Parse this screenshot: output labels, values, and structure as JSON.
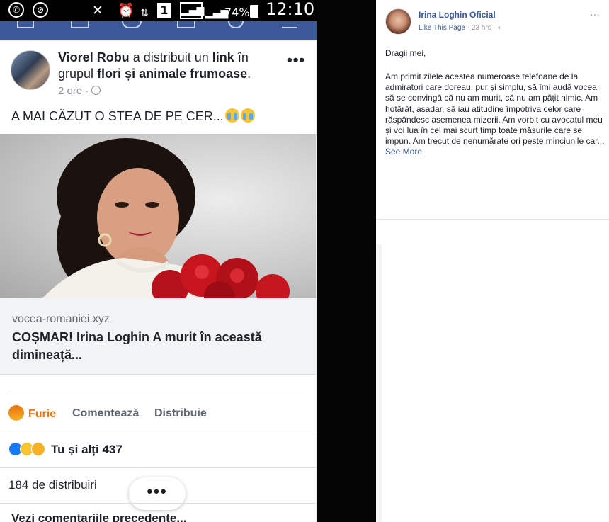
{
  "status_bar": {
    "time": "12:10",
    "battery": "74%",
    "sim_label": "1",
    "icons": [
      "whatsapp-icon",
      "blocked-icon",
      "mute-icon",
      "alarm-icon",
      "data-icon",
      "signal-icon",
      "battery-icon"
    ]
  },
  "mobile_post": {
    "author": "Viorel Robu",
    "action_pre": "a distribuit un",
    "action_link": "link",
    "action_in": "în grupul",
    "group": "flori și animale frumoase",
    "group_dot": ".",
    "time": "2 ore ·",
    "text": "A MAI CĂZUT O STEA DE PE CER...",
    "link_domain": "vocea-romaniei.xyz",
    "link_title": "COȘMAR! Irina Loghin A murit în această dimineață...",
    "reaction_label": "Furie",
    "comment_label": "Comentează",
    "share_label": "Distribuie",
    "reactions_summary": "Tu și alți 437",
    "shares_count": "184 de distribuiri",
    "more_label": "•••",
    "header_more": "•••",
    "previous_comments": "Vezi comentariile precedente..."
  },
  "desktop_post": {
    "page_name": "Irina Loghin Oficial",
    "like_page": "Like This Page",
    "meta": "· 23 hrs ·",
    "more": "···",
    "greeting": "Dragii mei,",
    "body": "Am primit zilele acestea numeroase telefoane de la admiratori care doreau, pur și simplu, să îmi audă vocea, să se convingă că nu am murit, că nu am pățit nimic. Am hotărât, așadar, să iau atitudine împotriva celor care răspândesc asemenea mizerii. Am vorbit cu avocatul meu și voi lua în cel mai scurt timp toate măsurile care se impun. Am trecut de nenumărate ori peste minciunile car...",
    "see_more": "See More"
  },
  "colors": {
    "facebook_blue": "#3b5998",
    "link_blue": "#365899",
    "angry_orange": "#e9710f"
  }
}
